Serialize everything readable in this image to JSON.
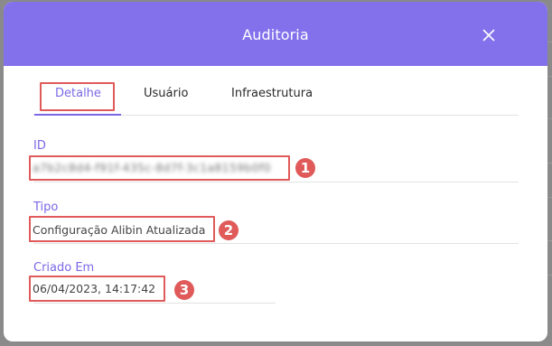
{
  "dialog": {
    "title": "Auditoria",
    "close_icon": "close-icon"
  },
  "tabs": [
    {
      "label": "Detalhe",
      "active": true
    },
    {
      "label": "Usuário",
      "active": false
    },
    {
      "label": "Infraestrutura",
      "active": false
    }
  ],
  "fields": {
    "id": {
      "label": "ID",
      "value": "a7b2c8d4-f91f-435c-8d7f-3c1a8159b0f0"
    },
    "tipo": {
      "label": "Tipo",
      "value": "Configuração Alibin Atualizada"
    },
    "criado_em": {
      "label": "Criado Em",
      "value": "06/04/2023, 14:17:42"
    }
  },
  "annotations": [
    "1",
    "2",
    "3"
  ],
  "colors": {
    "header": "#8371ec",
    "accent": "#7a68e6",
    "highlight": "#e05a5a"
  }
}
